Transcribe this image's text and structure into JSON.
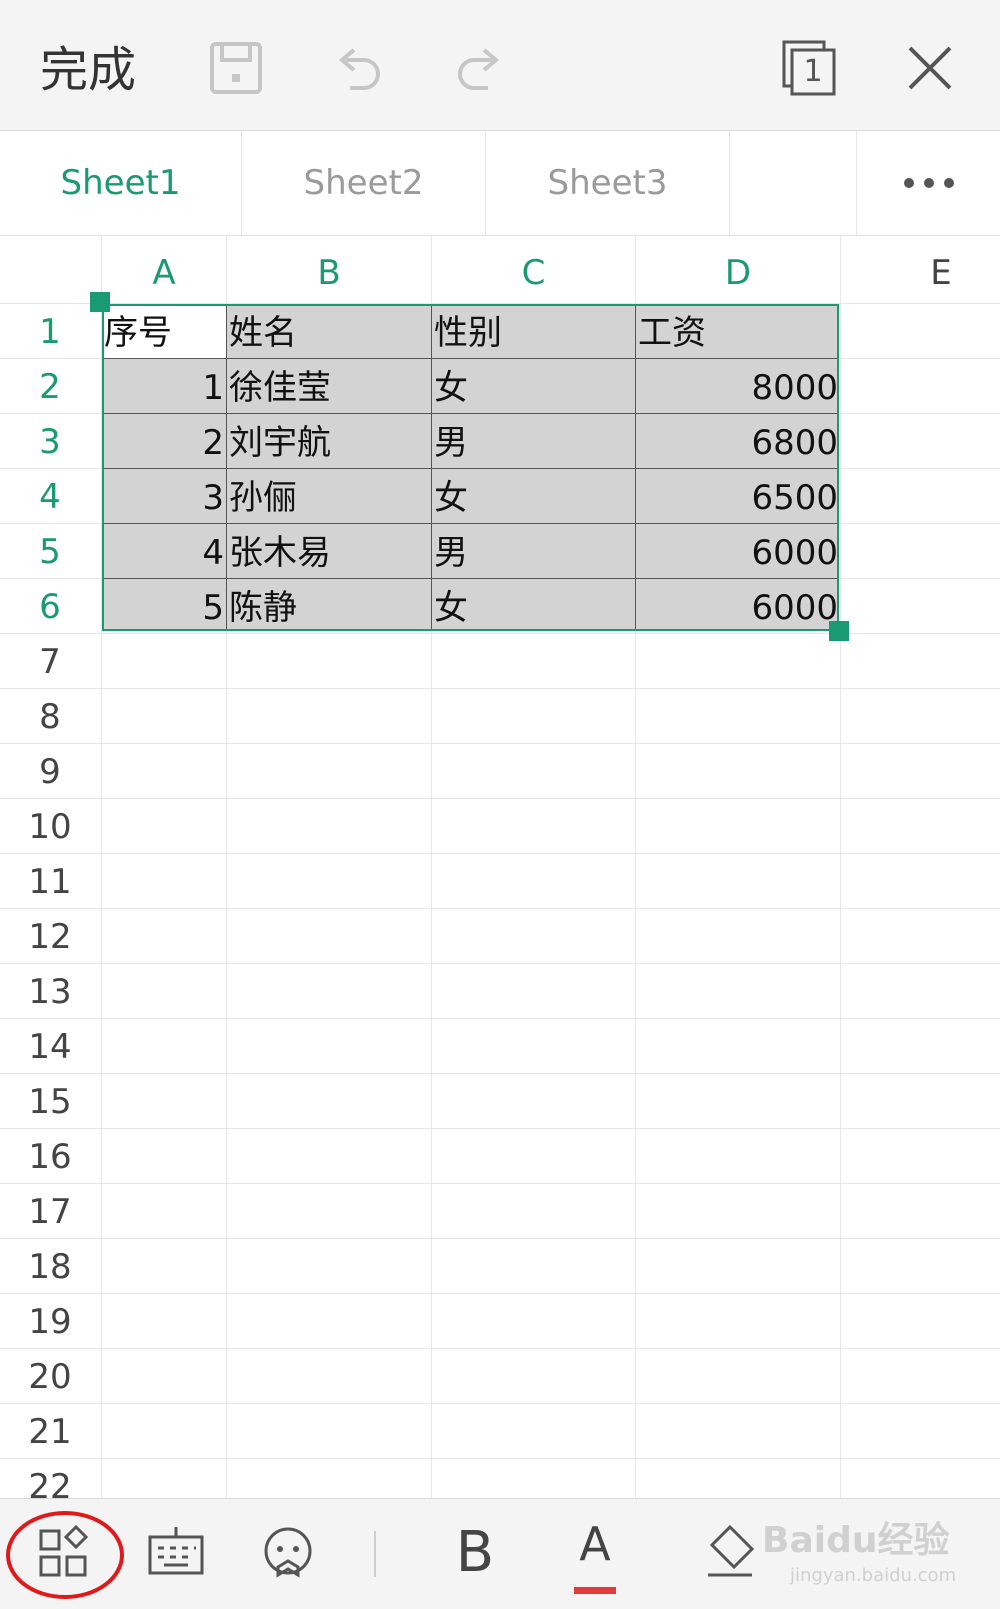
{
  "topbar": {
    "done_label": "完成",
    "window_count": "1"
  },
  "tabs": [
    {
      "label": "Sheet1"
    },
    {
      "label": "Sheet2"
    },
    {
      "label": "Sheet3"
    }
  ],
  "columns": [
    "A",
    "B",
    "C",
    "D",
    "E"
  ],
  "rows": [
    "1",
    "2",
    "3",
    "4",
    "5",
    "6",
    "7",
    "8",
    "9",
    "10",
    "11",
    "12",
    "13",
    "14",
    "15",
    "16",
    "17",
    "18",
    "19",
    "20",
    "21",
    "22"
  ],
  "cells": {
    "header": [
      "序号",
      "姓名",
      "性别",
      "工资"
    ],
    "data": [
      [
        "1",
        "徐佳莹",
        "女",
        "8000"
      ],
      [
        "2",
        "刘宇航",
        "男",
        "6800"
      ],
      [
        "3",
        "孙俪",
        "女",
        "6500"
      ],
      [
        "4",
        "张木易",
        "男",
        "6000"
      ],
      [
        "5",
        "陈静",
        "女",
        "6000"
      ]
    ]
  },
  "selection": {
    "range": "A1:D6",
    "color": "#1a9a73",
    "fill": "#d3d3d3"
  },
  "bottom_toolbar": {
    "bold_label": "B",
    "font_color_label": "A",
    "font_color": "#e23a3a"
  },
  "watermark": {
    "text": "Baidu经验",
    "sub": "jingyan.baidu.com"
  },
  "accent_color": "#1a9a73",
  "icons": [
    "save-icon",
    "undo-icon",
    "redo-icon",
    "window-switch-icon",
    "close-icon",
    "more-icon",
    "apps-icon",
    "keyboard-icon",
    "voice-icon",
    "fill-color-icon"
  ]
}
